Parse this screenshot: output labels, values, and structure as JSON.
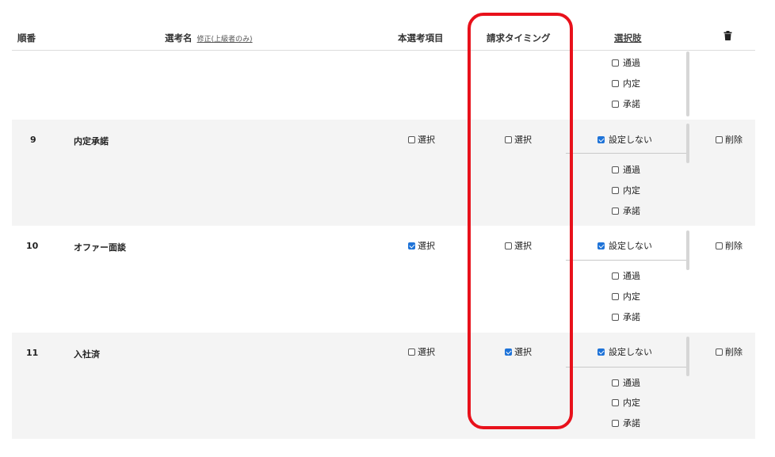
{
  "header": {
    "order": "順番",
    "name": "選考名",
    "name_edit_link": "修正(上級者のみ)",
    "main_item": "本選考項目",
    "billing_timing": "請求タイミング",
    "choices": "選択肢",
    "trash_icon": "trash-icon"
  },
  "top_partial": {
    "options": [
      {
        "label": "通過",
        "checked": false
      },
      {
        "label": "内定",
        "checked": false
      },
      {
        "label": "承諾",
        "checked": false
      }
    ]
  },
  "rows": [
    {
      "num": "9",
      "name": "内定承諾",
      "main": {
        "label": "選択",
        "checked": false
      },
      "billing": {
        "label": "選択",
        "checked": false
      },
      "no_setting": {
        "label": "設定しない",
        "checked": true
      },
      "options": [
        {
          "label": "通過",
          "checked": false
        },
        {
          "label": "内定",
          "checked": false
        },
        {
          "label": "承諾",
          "checked": false
        }
      ],
      "delete": {
        "label": "削除",
        "checked": false
      }
    },
    {
      "num": "10",
      "name": "オファー面談",
      "main": {
        "label": "選択",
        "checked": true
      },
      "billing": {
        "label": "選択",
        "checked": false
      },
      "no_setting": {
        "label": "設定しない",
        "checked": true
      },
      "options": [
        {
          "label": "通過",
          "checked": false
        },
        {
          "label": "内定",
          "checked": false
        },
        {
          "label": "承諾",
          "checked": false
        }
      ],
      "delete": {
        "label": "削除",
        "checked": false
      }
    },
    {
      "num": "11",
      "name": "入社済",
      "main": {
        "label": "選択",
        "checked": false
      },
      "billing": {
        "label": "選択",
        "checked": true
      },
      "no_setting": {
        "label": "設定しない",
        "checked": true
      },
      "options": [
        {
          "label": "通過",
          "checked": false
        },
        {
          "label": "内定",
          "checked": false
        },
        {
          "label": "承諾",
          "checked": false
        }
      ],
      "delete": {
        "label": "削除",
        "checked": false
      }
    }
  ],
  "colors": {
    "accent": "#1e73d8",
    "highlight": "#e8111b",
    "row_bg": "#f4f4f4"
  }
}
